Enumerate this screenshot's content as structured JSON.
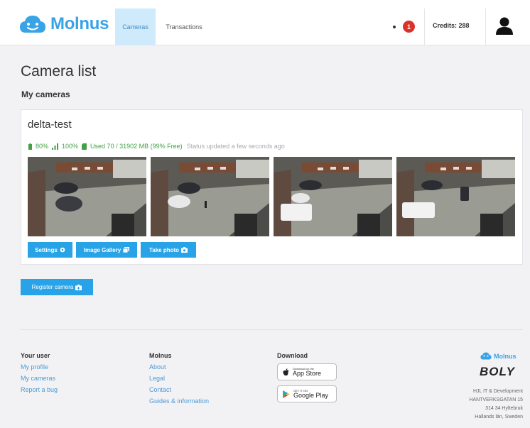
{
  "header": {
    "brand": "Molnus",
    "nav": [
      {
        "label": "Cameras",
        "active": true
      },
      {
        "label": "Transactions",
        "active": false
      }
    ],
    "notification_count": "1",
    "credits": "Credits: 288"
  },
  "page": {
    "title": "Camera list",
    "section": "My cameras"
  },
  "camera": {
    "name": "delta-test",
    "battery": "80%",
    "signal": "100%",
    "storage": "Used 70 / 31902 MB (99% Free)",
    "status_updated": "Status updated a few seconds ago",
    "buttons": {
      "settings": "Settings",
      "gallery": "Image Gallery",
      "photo": "Take photo"
    }
  },
  "register_label": "Register camera",
  "footer": {
    "col_user": {
      "heading": "Your user",
      "links": [
        "My profile",
        "My cameras",
        "Report a bug"
      ]
    },
    "col_molnus": {
      "heading": "Molnus",
      "links": [
        "About",
        "Legal",
        "Contact",
        "Guides & information"
      ]
    },
    "col_download": {
      "heading": "Download",
      "appstore_small": "Download on the",
      "appstore": "App Store",
      "gplay_small": "GET IT ON",
      "gplay": "Google Play"
    },
    "brand": "Molnus",
    "partner": "BOLY",
    "address": [
      "HJL IT & Development",
      "HANTVERKSGATAN 15",
      "314 34 Hyltebruk",
      "Hallands län, Sweden"
    ]
  },
  "colors": {
    "accent": "#29a3e8",
    "status_green": "#43a047",
    "badge_red": "#d9332b"
  }
}
